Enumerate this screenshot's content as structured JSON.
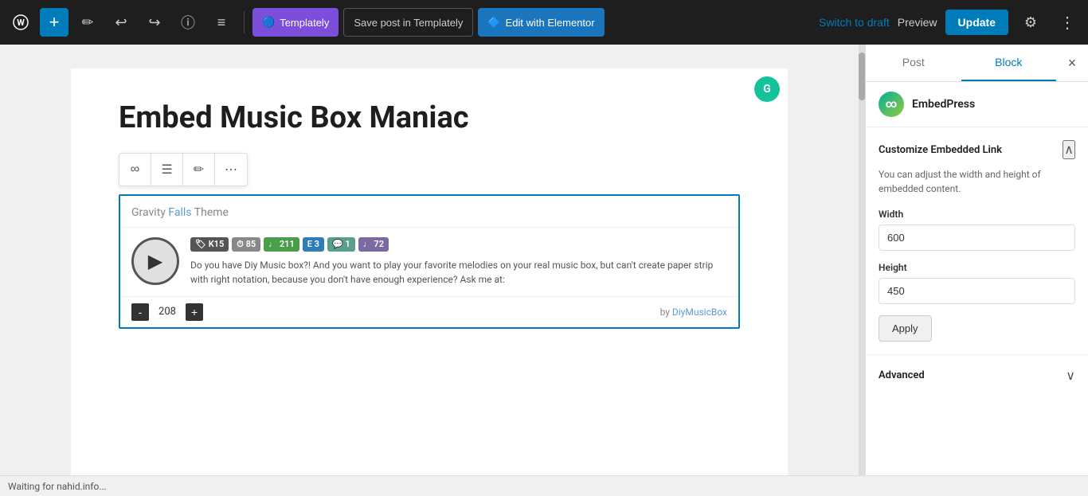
{
  "topbar": {
    "add_button": "+",
    "wp_logo": "W",
    "pencil_icon": "✏",
    "undo_icon": "↩",
    "redo_icon": "↪",
    "info_icon": "ⓘ",
    "list_icon": "☰",
    "templately_label": "Templately",
    "save_templately_label": "Save post in Templately",
    "elementor_label": "Edit with Elementor",
    "switch_draft_label": "Switch to draft",
    "preview_label": "Preview",
    "update_label": "Update",
    "settings_icon": "⚙",
    "more_icon": "⋮"
  },
  "editor": {
    "post_title": "Embed Music Box Maniac",
    "embed_header": "Gravity Falls Theme",
    "tags": [
      {
        "label": "K15",
        "color": "dark"
      },
      {
        "label": "⏱85",
        "color": "gray"
      },
      {
        "label": "♩211",
        "color": "green"
      },
      {
        "label": "E3",
        "color": "blue"
      },
      {
        "label": "💬1",
        "color": "teal"
      },
      {
        "label": "♩72",
        "color": "purple"
      }
    ],
    "embed_description": "Do you have Diy Music box?! And you want to play your favorite melodies on your real music box, but can't create paper strip with right notation, because you don't have enough experience? Ask me at:",
    "counter_minus": "-",
    "counter_value": "208",
    "counter_plus": "+",
    "embed_by": "by DiyMusicBox",
    "grammarly_label": "G"
  },
  "right_panel": {
    "tab_post": "Post",
    "tab_block": "Block",
    "close_icon": "×",
    "ep_icon": "∞",
    "ep_label": "EmbedPress",
    "customize_title": "Customize Embedded Link",
    "customize_desc": "You can adjust the width and height of embedded content.",
    "width_label": "Width",
    "width_value": "600",
    "height_label": "Height",
    "height_value": "450",
    "apply_label": "Apply",
    "advanced_label": "Advanced",
    "chevron_up": "∧",
    "chevron_down": "∨"
  },
  "status_bar": {
    "text": "Waiting for nahid.info..."
  }
}
